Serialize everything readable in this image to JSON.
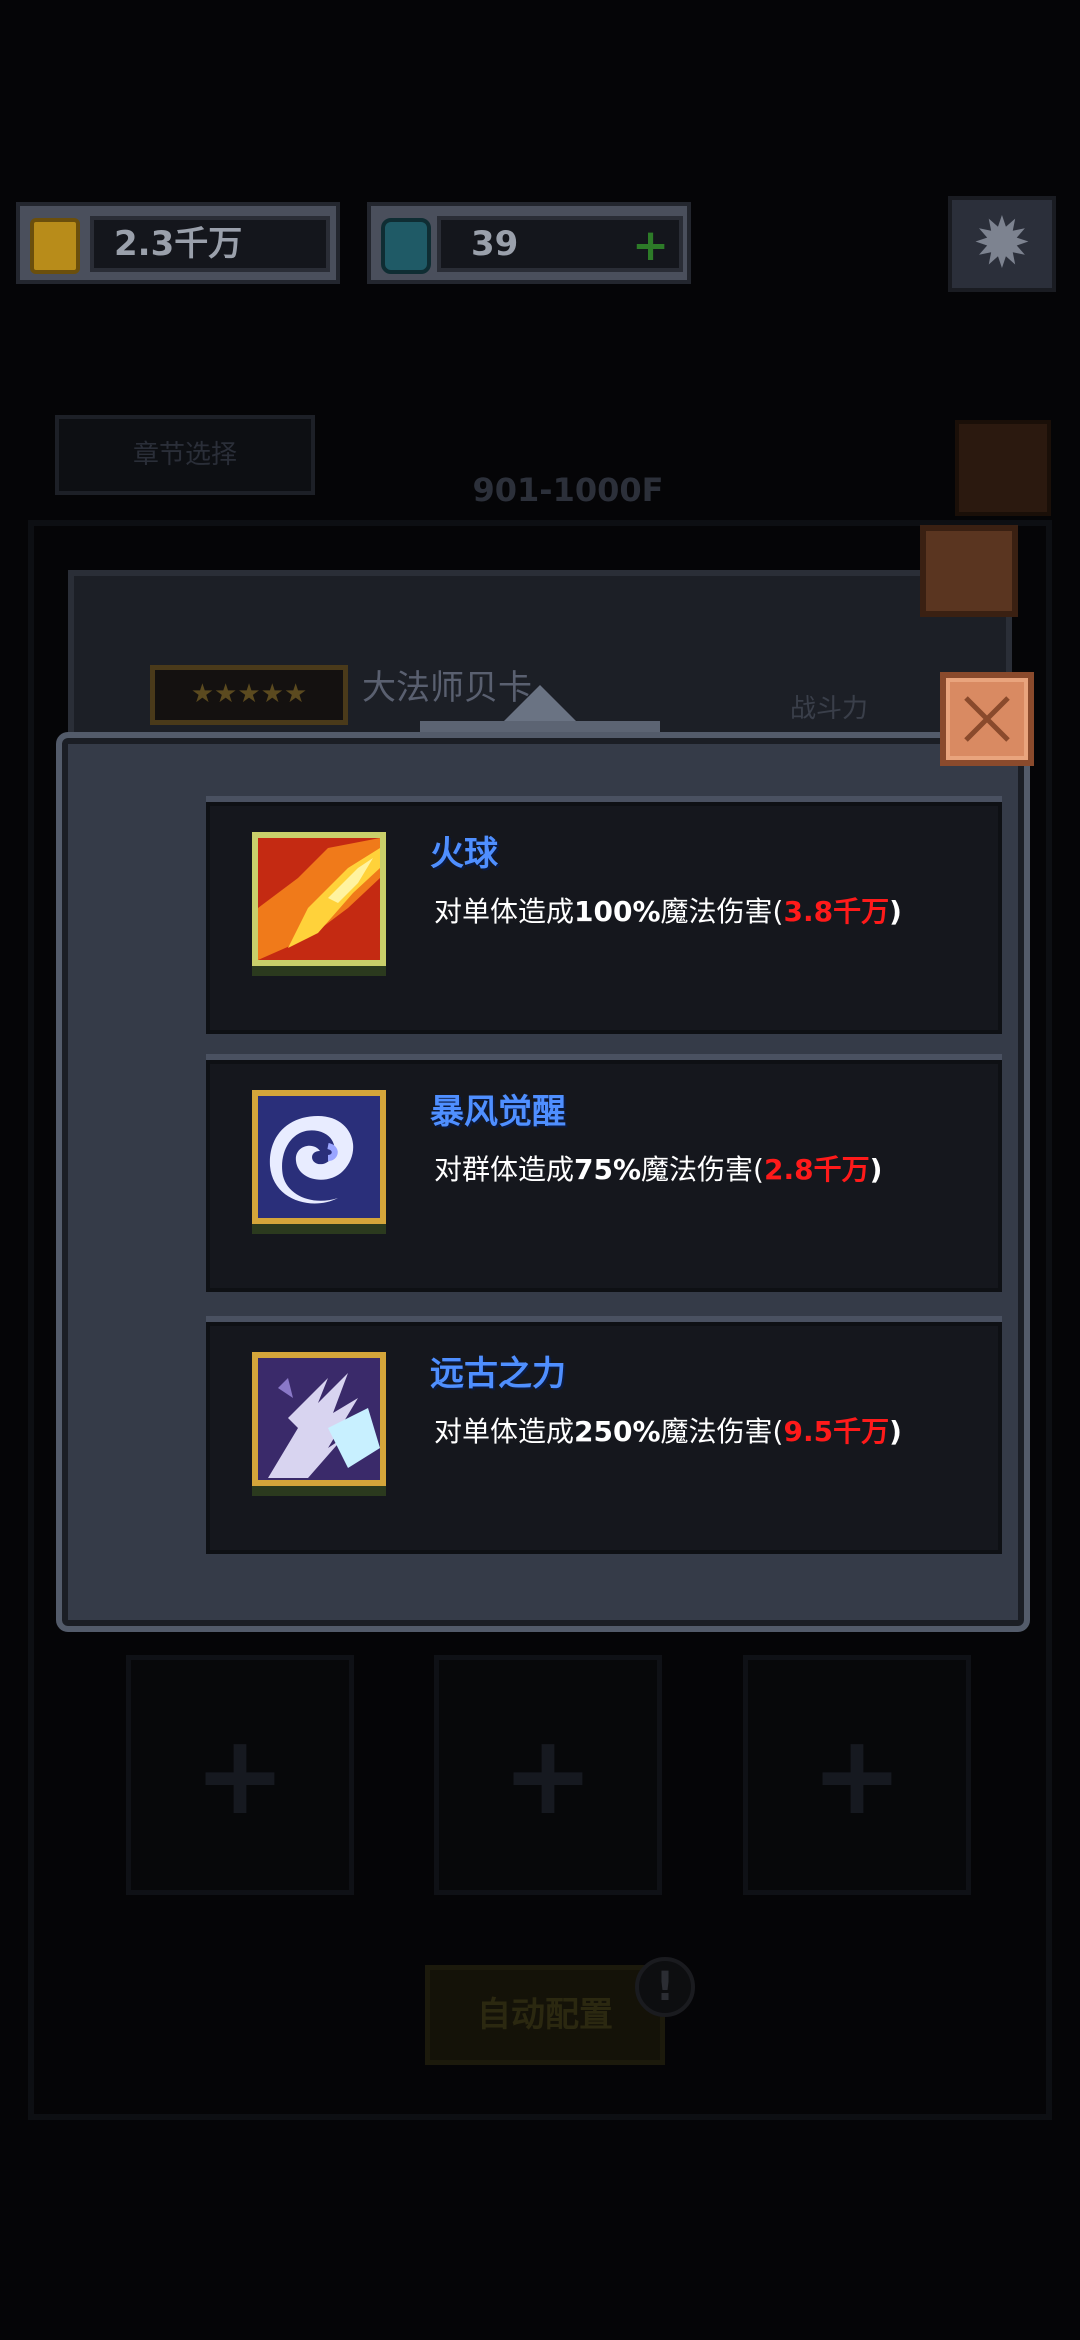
{
  "header": {
    "gold_amount": "2.3千万",
    "gem_amount": "39",
    "gem_add_label": "+",
    "icons": {
      "coin": "coin-icon",
      "gem": "gem-icon",
      "settings": "gear-icon"
    }
  },
  "background": {
    "chapter_select_label": "章节选择",
    "floor_range": "901-1000F",
    "hero_stars": "★★★★★",
    "hero_name": "大法师贝卡",
    "power_label": "战斗力",
    "slot_plus": "+",
    "auto_config_label": "自动配置",
    "auto_config_alert": "!"
  },
  "dialog": {
    "skills": [
      {
        "name": "火球",
        "desc_prefix": "对单体造成",
        "percent": "100%",
        "desc_mid": "魔法伤害(",
        "damage": "3.8千万",
        "desc_suffix": ")",
        "icon": "fireball-icon"
      },
      {
        "name": "暴风觉醒",
        "desc_prefix": "对群体造成",
        "percent": "75%",
        "desc_mid": "魔法伤害(",
        "damage": "2.8千万",
        "desc_suffix": ")",
        "icon": "storm-icon"
      },
      {
        "name": "远古之力",
        "desc_prefix": "对单体造成",
        "percent": "250%",
        "desc_mid": "魔法伤害(",
        "damage": "9.5千万",
        "desc_suffix": ")",
        "icon": "ancient-power-icon"
      }
    ]
  },
  "colors": {
    "skill_name": "#4f8fff",
    "damage": "#ff1a1a",
    "close_button": "#d98a62"
  }
}
